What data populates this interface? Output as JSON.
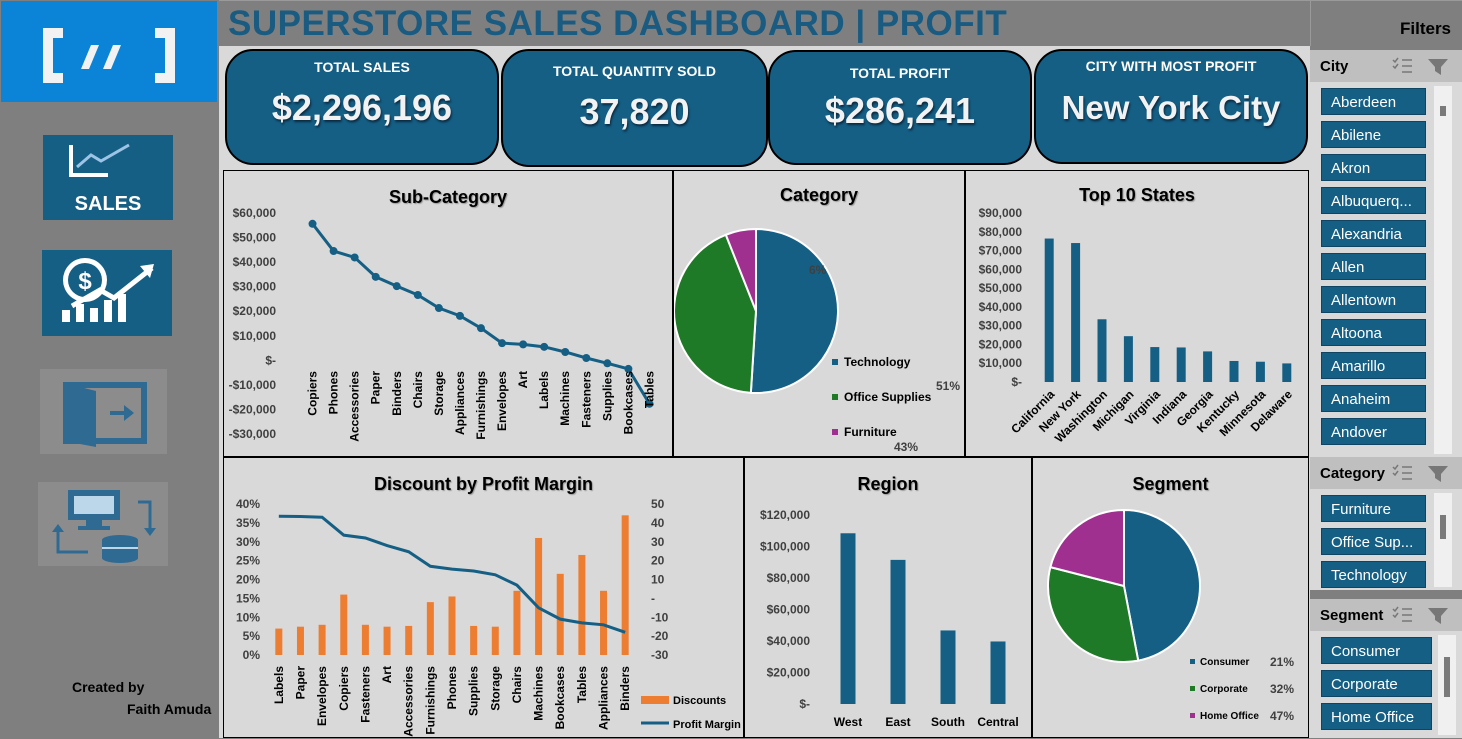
{
  "header": {
    "title": "SUPERSTORE SALES DASHBOARD | PROFIT",
    "filters_label": "Filters"
  },
  "sidebar": {
    "logo_text": "[//]",
    "nav": [
      {
        "label": "SALES",
        "icon": "sales-chart-icon"
      },
      {
        "label": "",
        "icon": "profit-dollar-icon"
      },
      {
        "label": "",
        "icon": "exit-door-icon"
      },
      {
        "label": "",
        "icon": "data-transfer-icon"
      }
    ],
    "created_by": "Created by",
    "author": "Faith Amuda"
  },
  "kpis": [
    {
      "label": "TOTAL SALES",
      "value": "$2,296,196"
    },
    {
      "label": "TOTAL QUANTITY SOLD",
      "value": "37,820"
    },
    {
      "label": "TOTAL PROFIT",
      "value": "$286,241"
    },
    {
      "label": "CITY WITH MOST PROFIT",
      "value": "New York City"
    }
  ],
  "colors": {
    "primary": "#155f85",
    "green": "#1e7a26",
    "purple": "#a0308f",
    "orange": "#ed7d31",
    "panel": "#d9d9d9"
  },
  "chart_data": [
    {
      "type": "line",
      "title": "Sub-Category",
      "categories": [
        "Copiers",
        "Phones",
        "Accessories",
        "Paper",
        "Binders",
        "Chairs",
        "Storage",
        "Appliances",
        "Furnishings",
        "Envelopes",
        "Art",
        "Labels",
        "Machines",
        "Fasteners",
        "Supplies",
        "Bookcases",
        "Tables"
      ],
      "values": [
        55600,
        44500,
        41900,
        34000,
        30200,
        26600,
        21300,
        18100,
        13100,
        7000,
        6500,
        5500,
        3400,
        950,
        -1200,
        -3500,
        -17700
      ],
      "ylim": [
        -30000,
        60000
      ],
      "yticks": [
        "$60,000",
        "$50,000",
        "$40,000",
        "$30,000",
        "$20,000",
        "$10,000",
        "$-",
        "-$10,000",
        "-$20,000",
        "-$30,000"
      ]
    },
    {
      "type": "pie",
      "title": "Category",
      "series": [
        {
          "name": "Technology",
          "value": 51,
          "label": "51%"
        },
        {
          "name": "Office Supplies",
          "value": 43,
          "label": "43%"
        },
        {
          "name": "Furniture",
          "value": 6,
          "label": "6%"
        }
      ],
      "legend": "right"
    },
    {
      "type": "bar",
      "title": "Top 10 States",
      "categories": [
        "California",
        "New York",
        "Washington",
        "Michigan",
        "Virginia",
        "Indiana",
        "Georgia",
        "Kentucky",
        "Minnesota",
        "Delaware"
      ],
      "values": [
        76400,
        74000,
        33400,
        24400,
        18600,
        18400,
        16300,
        11200,
        10800,
        9900
      ],
      "ylim": [
        0,
        90000
      ],
      "yticks": [
        "$90,000",
        "$80,000",
        "$70,000",
        "$60,000",
        "$50,000",
        "$40,000",
        "$30,000",
        "$20,000",
        "$10,000",
        "$-"
      ]
    },
    {
      "type": "bar",
      "title": "Discount by Profit Margin",
      "categories": [
        "Labels",
        "Paper",
        "Envelopes",
        "Copiers",
        "Fasteners",
        "Art",
        "Accessories",
        "Furnishings",
        "Phones",
        "Supplies",
        "Storage",
        "Chairs",
        "Machines",
        "Bookcases",
        "Tables",
        "Appliances",
        "Binders"
      ],
      "series": [
        {
          "name": "Discounts",
          "type": "bar",
          "axis": "left",
          "values": [
            0.07,
            0.075,
            0.08,
            0.16,
            0.08,
            0.075,
            0.077,
            0.14,
            0.155,
            0.077,
            0.075,
            0.17,
            0.31,
            0.215,
            0.265,
            0.17,
            0.37
          ]
        },
        {
          "name": "Profit Margin",
          "type": "line",
          "axis": "right",
          "values": [
            43.5,
            43.4,
            43.0,
            33.5,
            32.0,
            28.0,
            24.7,
            17.0,
            15.5,
            14.5,
            12.5,
            7.0,
            -5.0,
            -11.0,
            -13.0,
            -14.0,
            -18.0
          ]
        }
      ],
      "ylim_left": [
        0,
        0.4
      ],
      "ylim_right": [
        -30,
        50
      ],
      "yticks_left": [
        "40%",
        "35%",
        "30%",
        "25%",
        "20%",
        "15%",
        "10%",
        "5%",
        "0%"
      ],
      "yticks_right": [
        "50",
        "40",
        "30",
        "20",
        "10",
        "-",
        "-10",
        "-20",
        "-30"
      ],
      "legend": "bottom-right"
    },
    {
      "type": "bar",
      "title": "Region",
      "categories": [
        "West",
        "East",
        "South",
        "Central"
      ],
      "values": [
        108400,
        91500,
        46700,
        39700
      ],
      "ylim": [
        0,
        120000
      ],
      "yticks": [
        "$120,000",
        "$100,000",
        "$80,000",
        "$60,000",
        "$40,000",
        "$20,000",
        "$-"
      ]
    },
    {
      "type": "pie",
      "title": "Segment",
      "series": [
        {
          "name": "Consumer",
          "value": 47,
          "label": "47%"
        },
        {
          "name": "Corporate",
          "value": 32,
          "label": "32%"
        },
        {
          "name": "Home Office",
          "value": 21,
          "label": "21%"
        }
      ],
      "legend": "bottom-right"
    }
  ],
  "slicers": {
    "city": {
      "title": "City",
      "items": [
        "Aberdeen",
        "Abilene",
        "Akron",
        "Albuquerq...",
        "Alexandria",
        "Allen",
        "Allentown",
        "Altoona",
        "Amarillo",
        "Anaheim",
        "Andover"
      ]
    },
    "category": {
      "title": "Category",
      "items": [
        "Furniture",
        "Office Sup...",
        "Technology"
      ]
    },
    "segment": {
      "title": "Segment",
      "items": [
        "Consumer",
        "Corporate",
        "Home Office"
      ]
    }
  }
}
